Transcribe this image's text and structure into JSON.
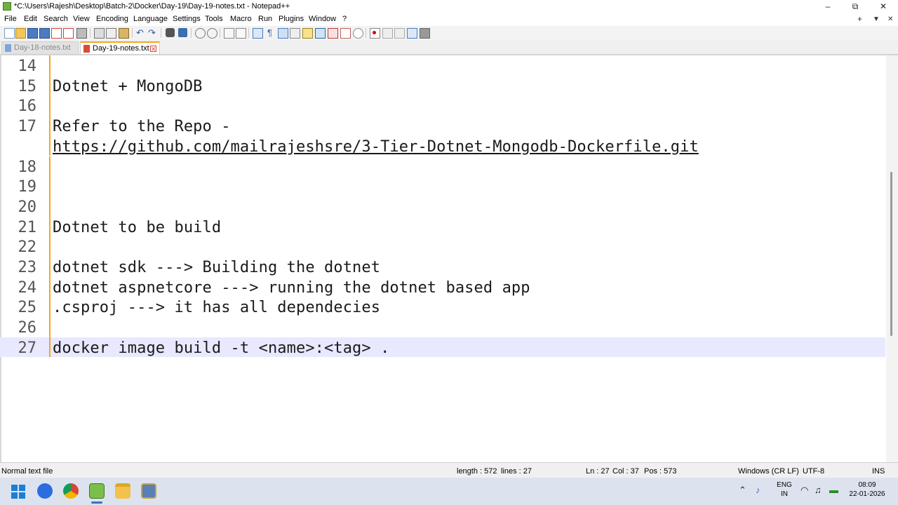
{
  "window": {
    "title": "*C:\\Users\\Rajesh\\Desktop\\Batch-2\\Docker\\Day-19\\Day-19-notes.txt - Notepad++",
    "controls": {
      "minimize": "–",
      "restore": "⧉",
      "close": "✕"
    }
  },
  "menu": {
    "items": [
      "File",
      "Edit",
      "Search",
      "View",
      "Encoding",
      "Language",
      "Settings",
      "Tools",
      "Macro",
      "Run",
      "Plugins",
      "Window",
      "?"
    ],
    "right": {
      "add": "+",
      "dropdown": "▼",
      "close": "✕"
    }
  },
  "toolbar": {
    "icons": [
      "new-file-icon",
      "open-file-icon",
      "save-icon",
      "save-all-icon",
      "close-icon",
      "close-all-icon",
      "print-icon",
      "cut-icon",
      "copy-icon",
      "paste-icon",
      "undo-icon",
      "redo-icon",
      "find-icon",
      "replace-icon",
      "zoom-in-icon",
      "zoom-out-icon",
      "sync-vertical-icon",
      "sync-horizontal-icon",
      "word-wrap-icon",
      "show-all-chars-icon",
      "indent-guide-icon",
      "doc-map-icon",
      "function-list-icon",
      "folder-workspace-icon",
      "doc-list-icon",
      "monitoring-icon",
      "record-macro-icon",
      "stop-record-icon",
      "playback-icon",
      "run-macro-multiple-icon",
      "save-macro-icon"
    ]
  },
  "tabs": [
    {
      "label": "Day-18-notes.txt",
      "active": false
    },
    {
      "label": "Day-19-notes.txt",
      "active": true,
      "close": "✕"
    }
  ],
  "editor": {
    "lines": [
      {
        "number": "14",
        "text": ""
      },
      {
        "number": "15",
        "text": "Dotnet + MongoDB"
      },
      {
        "number": "16",
        "text": ""
      },
      {
        "number": "17",
        "text": "Refer to the Repo -"
      },
      {
        "number": "",
        "text": "https://github.com/mailrajeshsre/3-Tier-Dotnet-Mongodb-Dockerfile.git",
        "link": true
      },
      {
        "number": "18",
        "text": ""
      },
      {
        "number": "19",
        "text": ""
      },
      {
        "number": "20",
        "text": ""
      },
      {
        "number": "21",
        "text": "Dotnet to be build"
      },
      {
        "number": "22",
        "text": ""
      },
      {
        "number": "23",
        "text": "dotnet sdk ---> Building the dotnet"
      },
      {
        "number": "24",
        "text": "dotnet aspnetcore ---> running the dotnet based app"
      },
      {
        "number": "25",
        "text": ".csproj ---> it has all dependecies"
      },
      {
        "number": "26",
        "text": ""
      },
      {
        "number": "27",
        "text": "docker image build -t <name>:<tag> .",
        "current": true
      }
    ]
  },
  "status": {
    "file_type": "Normal text file",
    "length": "length : 572",
    "lines": "lines : 27",
    "ln": "Ln : 27",
    "col": "Col : 37",
    "pos": "Pos : 573",
    "eol": "Windows (CR LF)",
    "encoding": "UTF-8",
    "mode": "INS"
  },
  "taskbar": {
    "apps": [
      "windows-start-icon",
      "zoom-icon",
      "chrome-icon",
      "notepad-plus-plus-icon",
      "file-explorer-icon",
      "remote-desktop-icon"
    ],
    "lang_top": "ENG",
    "lang_bottom": "IN",
    "time": "08:09",
    "date": "22-01-2026",
    "colors": {
      "accent": "#3b6ec7",
      "modified_marker": "#f5a623",
      "current_line": "#e8e8ff"
    }
  }
}
